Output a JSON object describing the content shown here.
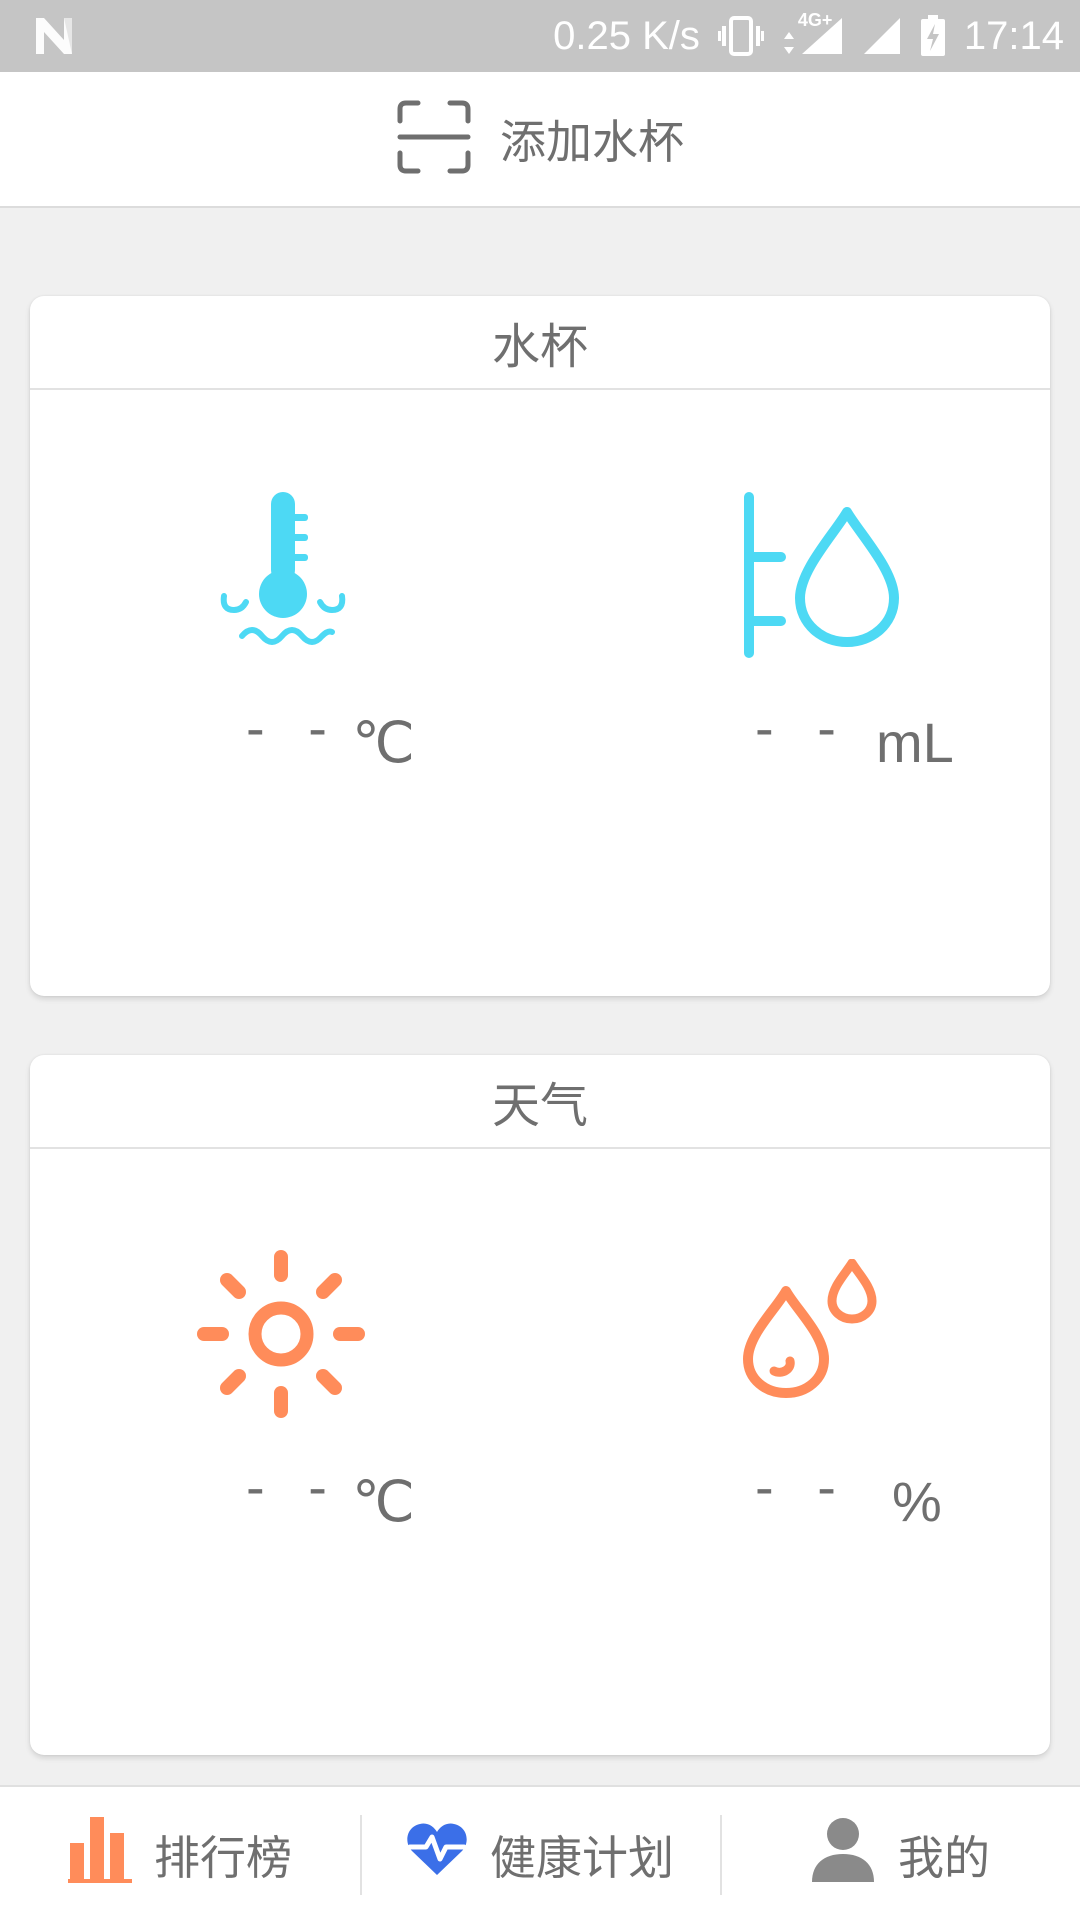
{
  "status_bar": {
    "speed": "0.25 K/s",
    "network": "4G+",
    "time": "17:14",
    "icons": [
      "notification-n-icon",
      "vibrate-icon",
      "data-arrows-icon",
      "signal-icon",
      "battery-charging-icon"
    ]
  },
  "app_bar": {
    "title": "添加水杯",
    "icon": "scan-icon"
  },
  "cards": {
    "cup": {
      "title": "水杯",
      "temperature": {
        "icon": "thermometer-icon",
        "value": "- -",
        "unit": "℃"
      },
      "volume": {
        "icon": "water-level-icon",
        "value": "- -",
        "unit": "mL"
      }
    },
    "weather": {
      "title": "天气",
      "temperature": {
        "icon": "sun-icon",
        "value": "- -",
        "unit": "℃"
      },
      "humidity": {
        "icon": "humidity-drops-icon",
        "value": "- -",
        "unit": "%"
      }
    }
  },
  "colors": {
    "cup_accent": "#4dd9f4",
    "weather_accent": "#ff8c5a",
    "health_accent": "#3b6fe8",
    "profile_gray": "#8a8a8a"
  },
  "bottom_nav": {
    "items": [
      {
        "label": "排行榜",
        "icon": "bar-chart-icon"
      },
      {
        "label": "健康计划",
        "icon": "heart-pulse-icon"
      },
      {
        "label": "我的",
        "icon": "person-icon"
      }
    ]
  }
}
